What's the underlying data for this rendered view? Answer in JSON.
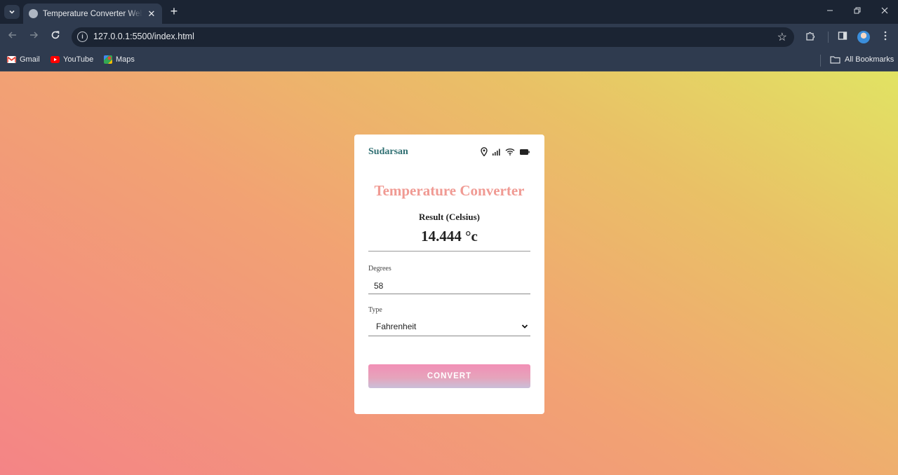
{
  "browser": {
    "tab_title": "Temperature Converter Website",
    "tab_close": "✕",
    "new_tab": "+",
    "url": "127.0.0.1:5500/index.html",
    "bookmarks": [
      {
        "label": "Gmail",
        "icon": "gmail-icon"
      },
      {
        "label": "YouTube",
        "icon": "youtube-icon"
      },
      {
        "label": "Maps",
        "icon": "maps-icon"
      }
    ],
    "all_bookmarks": "All Bookmarks",
    "colors": {
      "tabbar": "#1b2433",
      "toolbar": "#2f3b4f"
    }
  },
  "app": {
    "brand": "Sudarsan",
    "status_icons": [
      "location-icon",
      "signal-icon",
      "wifi-icon",
      "battery-icon"
    ],
    "title": "Temperature Converter",
    "result_label": "Result (Celsius)",
    "result_value": "14.444 °c",
    "degrees_label": "Degrees",
    "degrees_value": "58",
    "type_label": "Type",
    "type_value": "Fahrenheit",
    "convert_label": "CONVERT",
    "colors": {
      "title": "#f09a93",
      "brand": "#2f6f72",
      "button_top": "#f28fb6",
      "button_bottom": "#c9bfd9"
    }
  }
}
